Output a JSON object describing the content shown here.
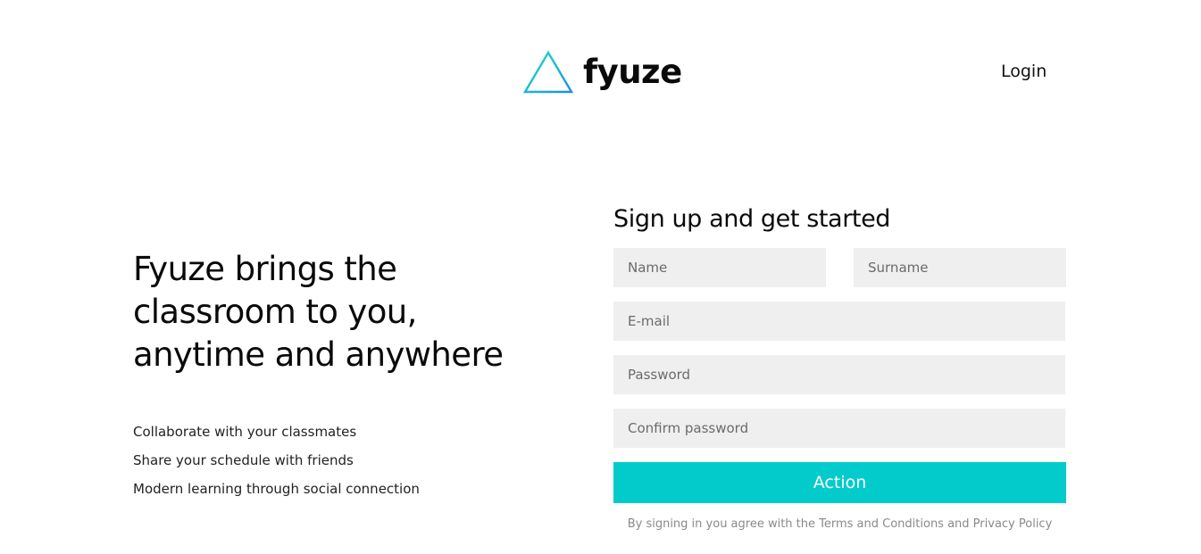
{
  "header": {
    "logo_text": "fyuze",
    "logo_icon": "triangle-logo-icon",
    "login_label": "Login"
  },
  "hero": {
    "title_line1": "Fyuze brings the",
    "title_line2": "classroom to you,",
    "title_line3": "anytime and anywhere",
    "features": [
      "Collaborate with your classmates",
      "Share your schedule with friends",
      "Modern learning through social connection"
    ]
  },
  "signup": {
    "title": "Sign up and get started",
    "name_placeholder": "Name",
    "surname_placeholder": "Surname",
    "email_placeholder": "E-mail",
    "password_placeholder": "Password",
    "confirm_password_placeholder": "Confirm password",
    "action_label": "Action",
    "terms_text": "By signing in you agree with the Terms and Conditions and Privacy Policy"
  },
  "colors": {
    "accent": "#03cbcb",
    "input_background": "#efefef",
    "logo_gradient_start": "#1fe0c0",
    "logo_gradient_end": "#1a8fe8"
  }
}
